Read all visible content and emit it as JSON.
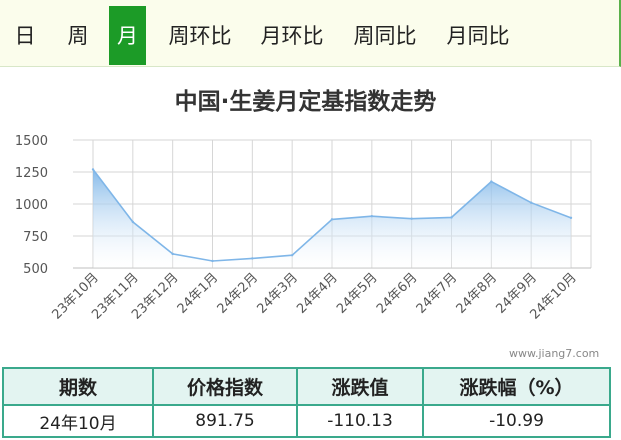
{
  "tabs": [
    {
      "label": "日",
      "active": false
    },
    {
      "label": "周",
      "active": false
    },
    {
      "label": "月",
      "active": true
    },
    {
      "label": "周环比",
      "active": false
    },
    {
      "label": "月环比",
      "active": false
    },
    {
      "label": "周同比",
      "active": false
    },
    {
      "label": "月同比",
      "active": false
    }
  ],
  "colors": {
    "accent": "#1c9b27",
    "line": "#7fb6e8",
    "table_border": "#3aa98c"
  },
  "watermark": "www.jiang7.com",
  "chart_data": {
    "type": "area",
    "title": "中国·生姜月定基指数走势",
    "categories": [
      "23年10月",
      "23年11月",
      "23年12月",
      "24年1月",
      "24年2月",
      "24年3月",
      "24年4月",
      "24年5月",
      "24年6月",
      "24年7月",
      "24年8月",
      "24年9月",
      "24年10月"
    ],
    "values": [
      1270,
      860,
      610,
      555,
      575,
      600,
      880,
      905,
      885,
      895,
      1175,
      1010,
      891.75
    ],
    "ylim": [
      500,
      1500
    ],
    "yticks": [
      "1500",
      "1250",
      "1000",
      "750",
      "500"
    ],
    "xlabel": "",
    "ylabel": "",
    "grid": true
  },
  "summary_table": {
    "headers": [
      "期数",
      "价格指数",
      "涨跌值",
      "涨跌幅（%）"
    ],
    "row": [
      "24年10月",
      "891.75",
      "-110.13",
      "-10.99"
    ]
  }
}
